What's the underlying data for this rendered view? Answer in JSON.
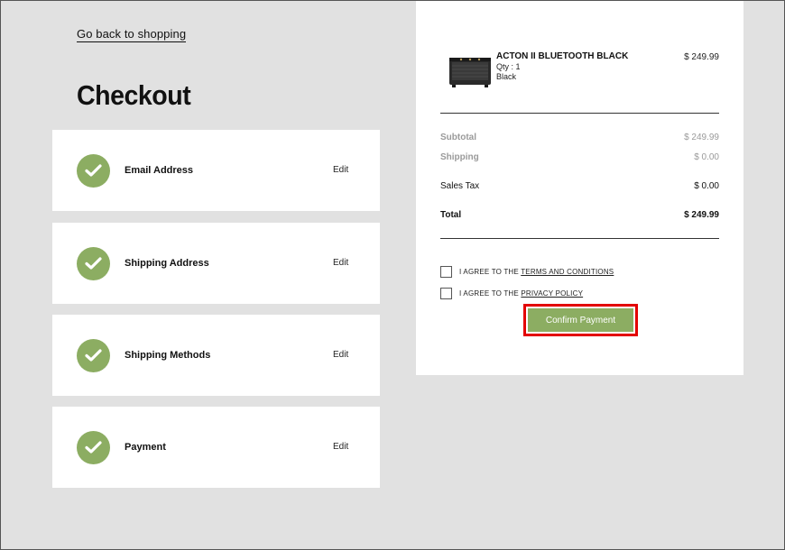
{
  "nav": {
    "back_label": "Go back to shopping"
  },
  "page": {
    "title": "Checkout"
  },
  "steps": [
    {
      "label": "Email Address",
      "edit": "Edit"
    },
    {
      "label": "Shipping Address",
      "edit": "Edit"
    },
    {
      "label": "Shipping Methods",
      "edit": "Edit"
    },
    {
      "label": "Payment",
      "edit": "Edit"
    }
  ],
  "product": {
    "name": "ACTON II BLUETOOTH BLACK",
    "qty": "Qty : 1",
    "color": "Black",
    "price": "$ 249.99"
  },
  "totals": {
    "subtotal_label": "Subtotal",
    "subtotal_value": "$ 249.99",
    "shipping_label": "Shipping",
    "shipping_value": "$ 0.00",
    "tax_label": "Sales Tax",
    "tax_value": "$ 0.00",
    "total_label": "Total",
    "total_value": "$ 249.99"
  },
  "agreements": [
    {
      "prefix": "I AGREE TO THE ",
      "link": "TERMS AND CONDITIONS"
    },
    {
      "prefix": "I AGREE TO THE ",
      "link": "PRIVACY POLICY"
    }
  ],
  "confirm_label": "Confirm Payment",
  "colors": {
    "accent": "#8cad62",
    "highlight": "#e30000",
    "background": "#e1e1e1"
  },
  "icons": {
    "step": "check-icon"
  }
}
